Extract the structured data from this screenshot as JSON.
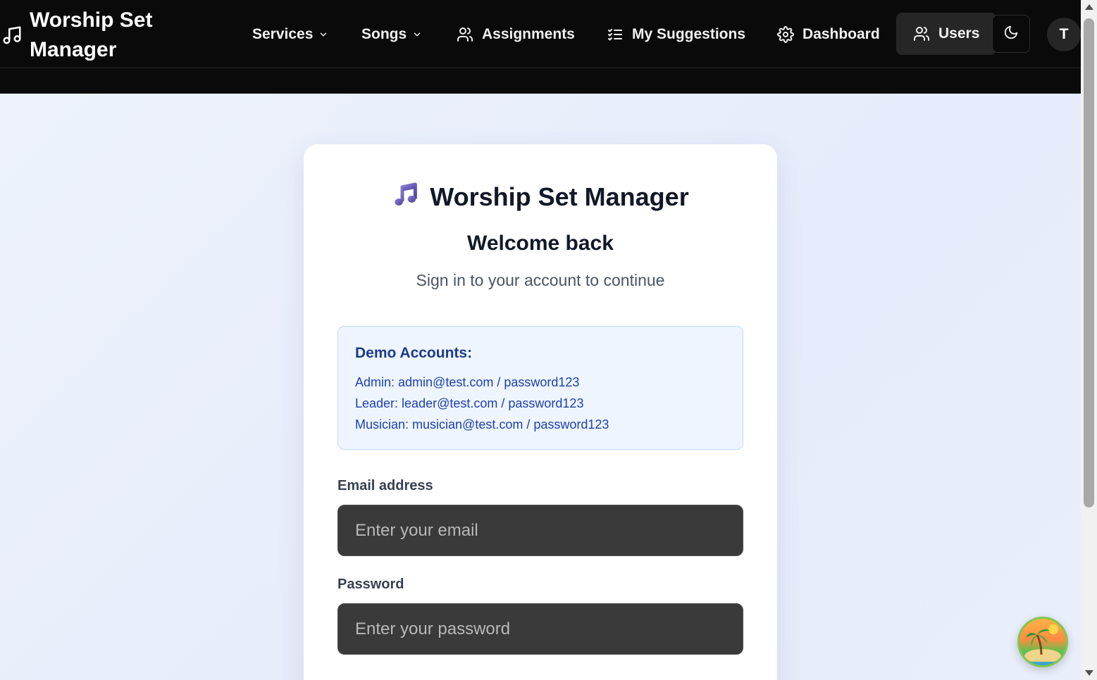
{
  "app": {
    "brand_title": "Worship Set Manager",
    "icons": {
      "brand": "music-note-icon"
    }
  },
  "nav": {
    "services": "Services",
    "songs": "Songs",
    "assignments": "Assignments",
    "my_suggestions": "My Suggestions",
    "dashboard": "Dashboard",
    "users": "Users",
    "avatar_initial": "T",
    "icons": {
      "services_chevron": "chevron-down-icon",
      "songs_chevron": "chevron-down-icon",
      "assignments": "users-icon",
      "my_suggestions": "list-checks-icon",
      "dashboard": "gear-icon",
      "users": "users-icon",
      "theme": "moon-icon"
    }
  },
  "login": {
    "brand_title": "Worship Set Manager",
    "welcome": "Welcome back",
    "subtitle": "Sign in to your account to continue",
    "demo": {
      "title": "Demo Accounts:",
      "lines": [
        "Admin: admin@test.com / password123",
        "Leader: leader@test.com / password123",
        "Musician: musician@test.com / password123"
      ]
    },
    "email": {
      "label": "Email address",
      "placeholder": "Enter your email",
      "value": ""
    },
    "password": {
      "label": "Password",
      "placeholder": "Enter your password",
      "value": ""
    }
  },
  "colors": {
    "topbar": "#0a0a0a",
    "accent_purple": "#6b5bb5",
    "demo_bg": "#eef5ff",
    "demo_text": "#1e40af",
    "input_bg": "#3a3a3a"
  }
}
